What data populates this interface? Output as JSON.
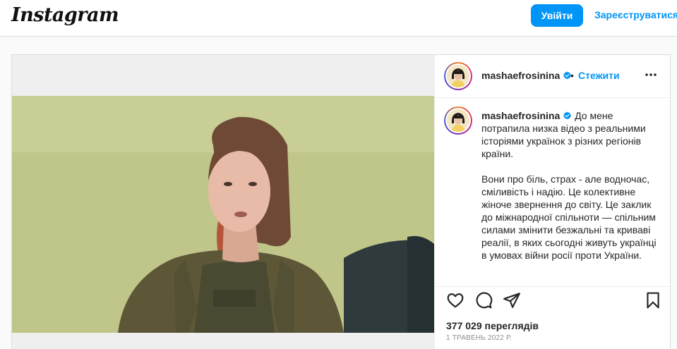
{
  "header": {
    "logo": "Instagram",
    "login_label": "Увійти",
    "signup_label": "Зареєструватися"
  },
  "post": {
    "author": "mashaefrosinina",
    "verified": true,
    "dot": "•",
    "follow_label": "Стежити",
    "caption_p1": "До мене потрапила низка відео з реальними історіями українок з різних регіонів країни.",
    "caption_p2": "Вони про біль, страх - але водночас, сміливість і надію. Це колективне жіноче звернення до світу. Це заклик до міжнародної спільноти — спільним силами змінити безжальні та криваві реалії, в яких сьогодні живуть українці в умовах війни росії проти України.",
    "views": "377 029 переглядів",
    "date": "1 ТРАВЕНЬ 2022 Р."
  },
  "icons": {
    "like": "heart-icon",
    "comment": "comment-icon",
    "share": "paper-plane-icon",
    "save": "bookmark-icon",
    "more": "more-horizontal-icon",
    "mute": "speaker-muted-icon",
    "verified": "verified-badge-icon"
  },
  "colors": {
    "accent": "#0095f6",
    "video_bg": "#c1c78a"
  }
}
